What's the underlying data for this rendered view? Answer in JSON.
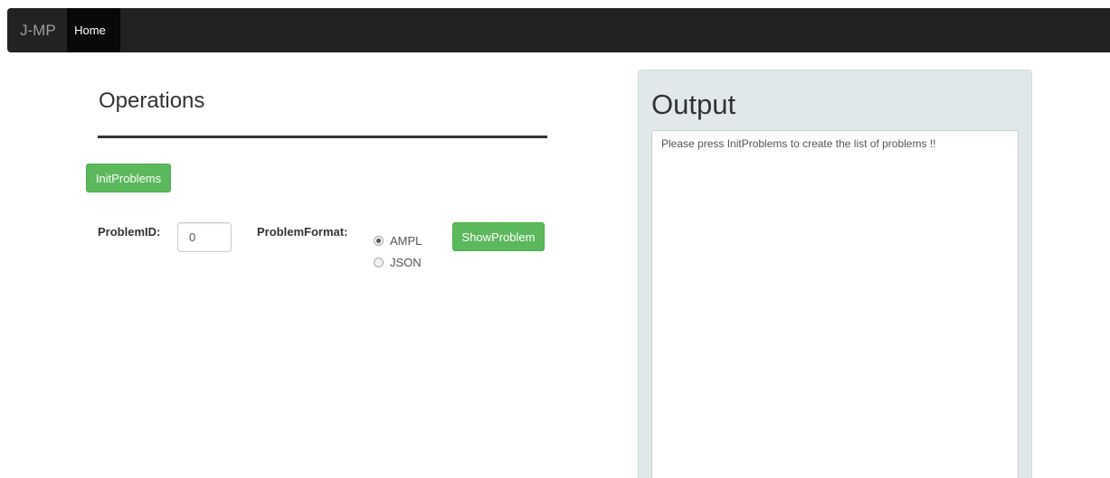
{
  "navbar": {
    "brand": "J-MP",
    "home_label": "Home"
  },
  "operations": {
    "title": "Operations",
    "init_button": "InitProblems",
    "problem_id_label": "ProblemID:",
    "problem_id_value": "0",
    "problem_format_label": "ProblemFormat:",
    "formats": [
      {
        "label": "AMPL",
        "checked": true
      },
      {
        "label": "JSON",
        "checked": false
      }
    ],
    "show_button": "ShowProblem"
  },
  "output": {
    "title": "Output",
    "text": "Please press InitProblems to create the list of problems !!"
  },
  "colors": {
    "navbar_bg": "#222222",
    "nav_active_bg": "#080808",
    "button_green": "#5cb85c",
    "output_panel_bg": "#e0e8ea"
  }
}
